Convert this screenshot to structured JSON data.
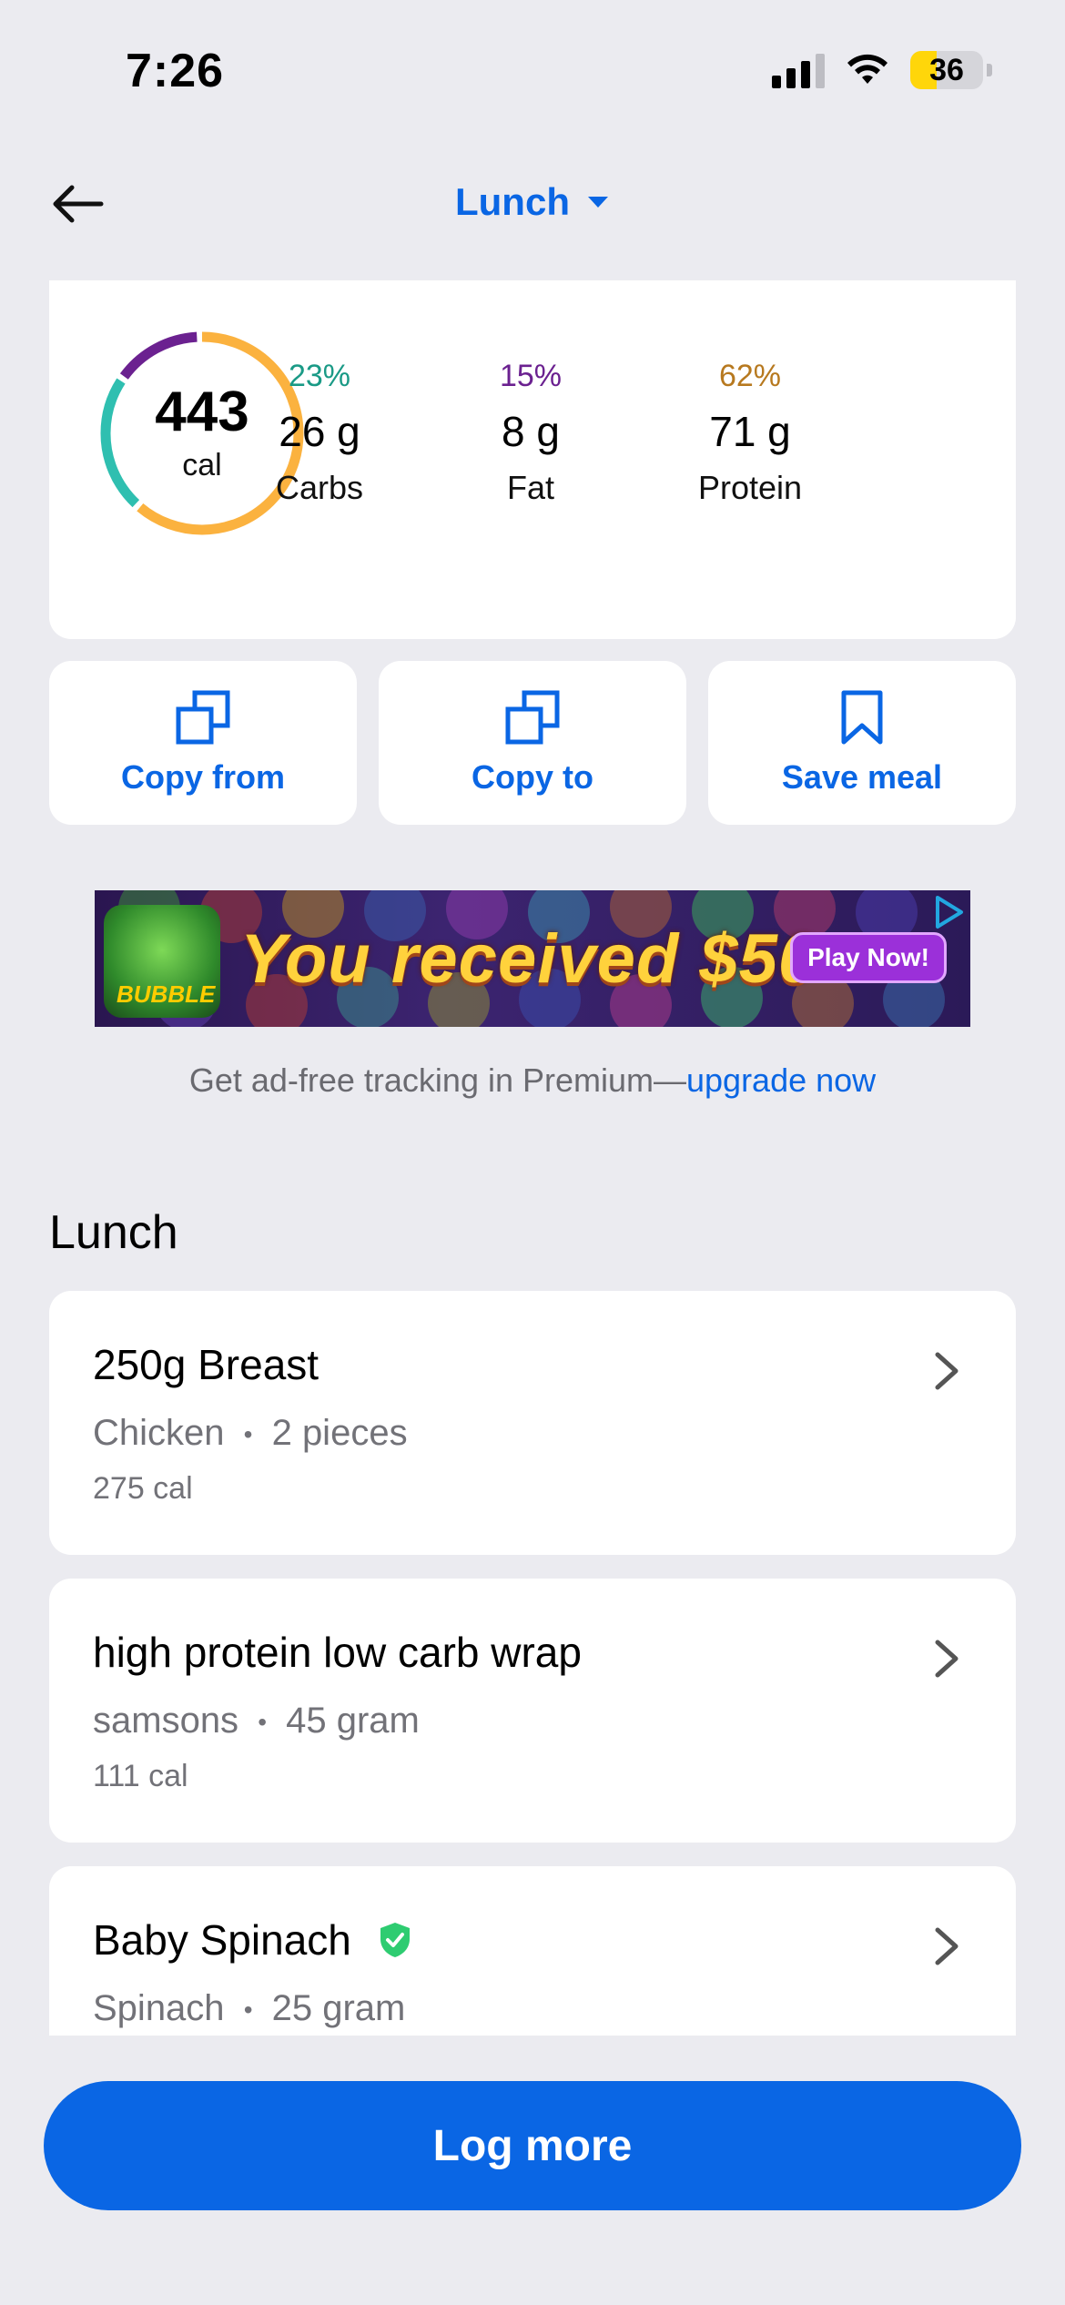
{
  "status_bar": {
    "time": "7:26",
    "battery_level": "36",
    "icons": [
      "cellular-signal-icon",
      "wifi-icon",
      "battery-icon"
    ]
  },
  "header": {
    "meal": "Lunch",
    "icons": [
      "back-arrow-icon",
      "caret-down-icon"
    ]
  },
  "summary": {
    "calories": "443",
    "calories_unit": "cal",
    "macros": [
      {
        "percent": "23%",
        "amount": "26 g",
        "name": "Carbs",
        "color": "#1a9a86"
      },
      {
        "percent": "15%",
        "amount": "8 g",
        "name": "Fat",
        "color": "#6b2190"
      },
      {
        "percent": "62%",
        "amount": "71 g",
        "name": "Protein",
        "color": "#b7791f"
      }
    ],
    "ring_colors": {
      "carbs": "#2fbfb0",
      "fat": "#6b2190",
      "protein": "#fbb23f"
    }
  },
  "actions": {
    "copy_from": "Copy from",
    "copy_to": "Copy to",
    "save_meal": "Save meal",
    "icons": [
      "copy-icon",
      "copy-icon",
      "bookmark-icon"
    ]
  },
  "ad": {
    "logo_text": "BUBBLE",
    "headline": "You received $50",
    "cta": "Play Now!",
    "note_prefix": "Get ad-free tracking in Premium—",
    "note_link": "upgrade now"
  },
  "section": {
    "title": "Lunch",
    "entries": [
      {
        "name": "250g Breast",
        "brand": "Chicken",
        "serving": "2 pieces",
        "calories": "275 cal",
        "verified": false
      },
      {
        "name": "high protein low carb wrap",
        "brand": "samsons",
        "serving": "45 gram",
        "calories": "111 cal",
        "verified": false
      },
      {
        "name": "Baby Spinach",
        "brand": "Spinach",
        "serving": "25 gram",
        "calories": "",
        "verified": true
      }
    ],
    "separator": "•"
  },
  "footer": {
    "log_more": "Log more"
  },
  "colors": {
    "accent": "#0a66e4",
    "background": "#ebebf0",
    "verified": "#2ecc71"
  }
}
